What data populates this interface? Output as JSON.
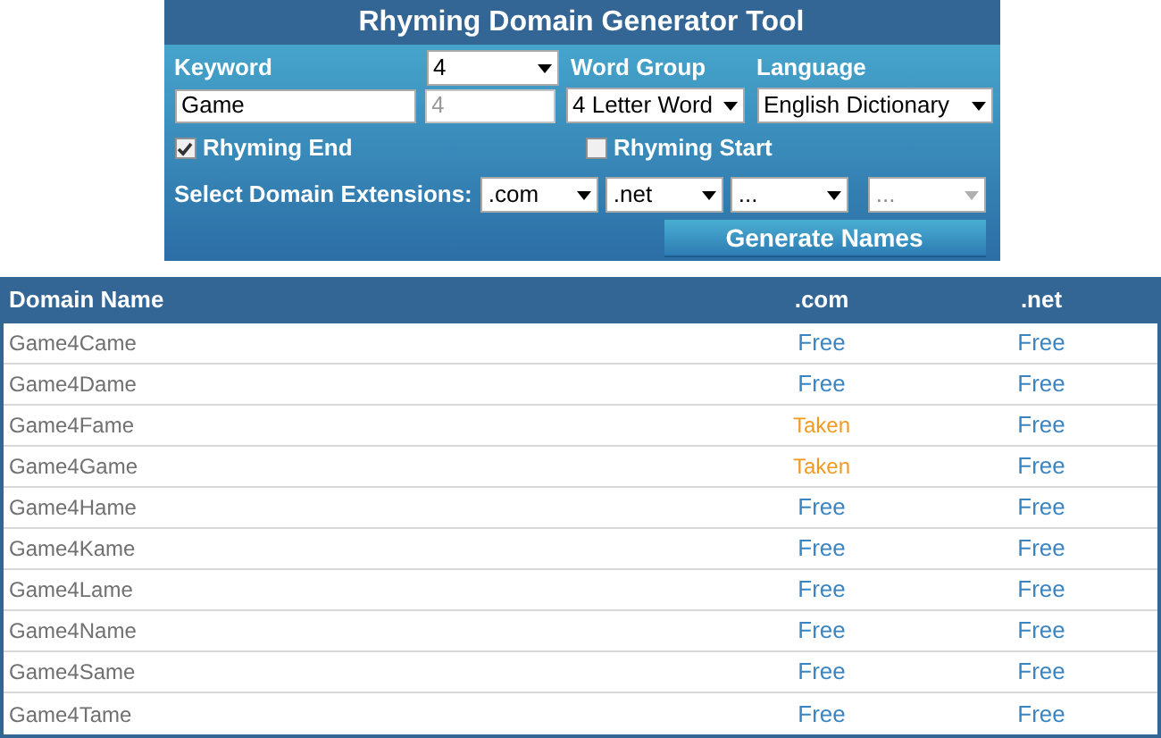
{
  "tool": {
    "title": "Rhyming Domain Generator Tool",
    "keyword": {
      "label": "Keyword",
      "value": "Game"
    },
    "count": {
      "value": "4"
    },
    "count_field": {
      "placeholder": "4"
    },
    "word_group": {
      "label": "Word Group",
      "value": "4 Letter Word"
    },
    "language": {
      "label": "Language",
      "value": "English Dictionary"
    },
    "options": [
      {
        "label": "Rhyming End",
        "checked": true
      },
      {
        "label": "Rhyming Start",
        "checked": false
      }
    ],
    "extensions_label": "Select Domain Extensions:",
    "extensions": [
      {
        "value": ".com",
        "disabled": false
      },
      {
        "value": ".net",
        "disabled": false
      },
      {
        "value": "...",
        "disabled": false
      },
      {
        "value": "...",
        "disabled": true
      }
    ],
    "generate_button": "Generate Names"
  },
  "table": {
    "columns": [
      "Domain Name",
      ".com",
      ".net"
    ],
    "rows": [
      {
        "cells": [
          {
            "text": "Game4Came"
          },
          {
            "text": "Free",
            "available": true
          },
          {
            "text": "Free",
            "available": true
          }
        ]
      },
      {
        "cells": [
          {
            "text": "Game4Dame"
          },
          {
            "text": "Free",
            "available": true
          },
          {
            "text": "Free",
            "available": true
          }
        ]
      },
      {
        "cells": [
          {
            "text": "Game4Fame"
          },
          {
            "text": "Taken",
            "available": false
          },
          {
            "text": "Free",
            "available": true
          }
        ]
      },
      {
        "cells": [
          {
            "text": "Game4Game"
          },
          {
            "text": "Taken",
            "available": false
          },
          {
            "text": "Free",
            "available": true
          }
        ]
      },
      {
        "cells": [
          {
            "text": "Game4Hame"
          },
          {
            "text": "Free",
            "available": true
          },
          {
            "text": "Free",
            "available": true
          }
        ]
      },
      {
        "cells": [
          {
            "text": "Game4Kame"
          },
          {
            "text": "Free",
            "available": true
          },
          {
            "text": "Free",
            "available": true
          }
        ]
      },
      {
        "cells": [
          {
            "text": "Game4Lame"
          },
          {
            "text": "Free",
            "available": true
          },
          {
            "text": "Free",
            "available": true
          }
        ]
      },
      {
        "cells": [
          {
            "text": "Game4Name"
          },
          {
            "text": "Free",
            "available": true
          },
          {
            "text": "Free",
            "available": true
          }
        ]
      },
      {
        "cells": [
          {
            "text": "Game4Same"
          },
          {
            "text": "Free",
            "available": true
          },
          {
            "text": "Free",
            "available": true
          }
        ]
      },
      {
        "cells": [
          {
            "text": "Game4Tame"
          },
          {
            "text": "Free",
            "available": true
          },
          {
            "text": "Free",
            "available": true
          }
        ]
      }
    ]
  }
}
